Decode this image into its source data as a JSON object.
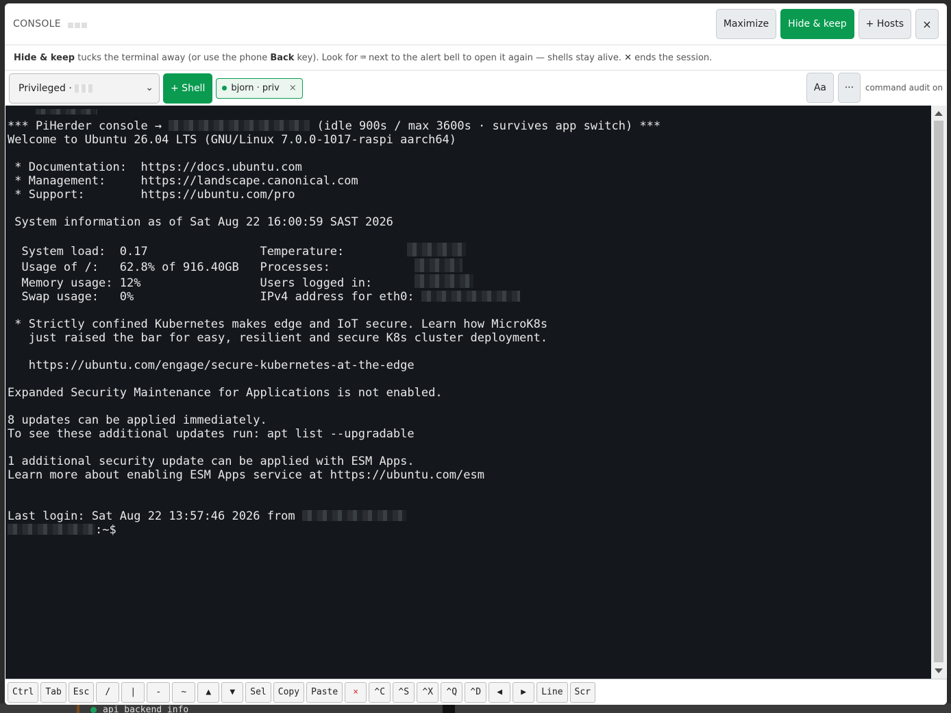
{
  "window": {
    "title": "CONSOLE",
    "buttons": {
      "maximize": "Maximize",
      "hide_keep": "Hide & keep",
      "hosts": "+ Hosts",
      "close": "×"
    }
  },
  "hint": {
    "b1": "Hide & keep",
    "t1": " tucks the terminal away (or use the phone ",
    "b2": "Back",
    "t2": " key). Look for",
    "kb": "⌨",
    "t3": "next to the alert bell to open it again — shells stay alive. ",
    "x": "✕",
    "t4": " ends the session."
  },
  "toolbar": {
    "select_label": "Privileged ·",
    "shell_button": "+ Shell",
    "chip_label": "bjorn · priv",
    "chip_close": "×",
    "font_button": "Aa",
    "more_button": "···",
    "audit": "command audit on"
  },
  "terminal": {
    "l1a": "*** PiHerder console → ",
    "l1b": " (idle 900s / max 3600s · survives app switch) ***",
    "l2": "Welcome to Ubuntu 26.04 LTS (GNU/Linux 7.0.0-1017-raspi aarch64)",
    "l4": " * Documentation:  https://docs.ubuntu.com",
    "l5": " * Management:     https://landscape.canonical.com",
    "l6": " * Support:        https://ubuntu.com/pro",
    "l8": " System information as of Sat Aug 22 16:00:59 SAST 2026",
    "l10": "  System load:  0.17                Temperature:",
    "l11": "  Usage of /:   62.8% of 916.40GB   Processes:",
    "l12": "  Memory usage: 12%                 Users logged in:",
    "l13": "  Swap usage:   0%                  IPv4 address for eth0: ",
    "l15": " * Strictly confined Kubernetes makes edge and IoT secure. Learn how MicroK8s",
    "l16": "   just raised the bar for easy, resilient and secure K8s cluster deployment.",
    "l18": "   https://ubuntu.com/engage/secure-kubernetes-at-the-edge",
    "l20": "Expanded Security Maintenance for Applications is not enabled.",
    "l22": "8 updates can be applied immediately.",
    "l23": "To see these additional updates run: apt list --upgradable",
    "l25": "1 additional security update can be applied with ESM Apps.",
    "l26": "Learn more about enabling ESM Apps service at https://ubuntu.com/esm",
    "l29": "Last login: Sat Aug 22 13:57:46 2026 from ",
    "prompt": ":~$"
  },
  "keys": [
    "Ctrl",
    "Tab",
    "Esc",
    "/",
    "|",
    "-",
    "~",
    "▲",
    "▼",
    "Sel",
    "Copy",
    "Paste",
    "×",
    "^C",
    "^S",
    "^X",
    "^Q",
    "^D",
    "◀",
    "▶",
    "Line",
    "Scr"
  ],
  "background": {
    "peek_text": "api backend info"
  },
  "colors": {
    "accent": "#0a9b50",
    "terminal_bg": "#14181d"
  }
}
